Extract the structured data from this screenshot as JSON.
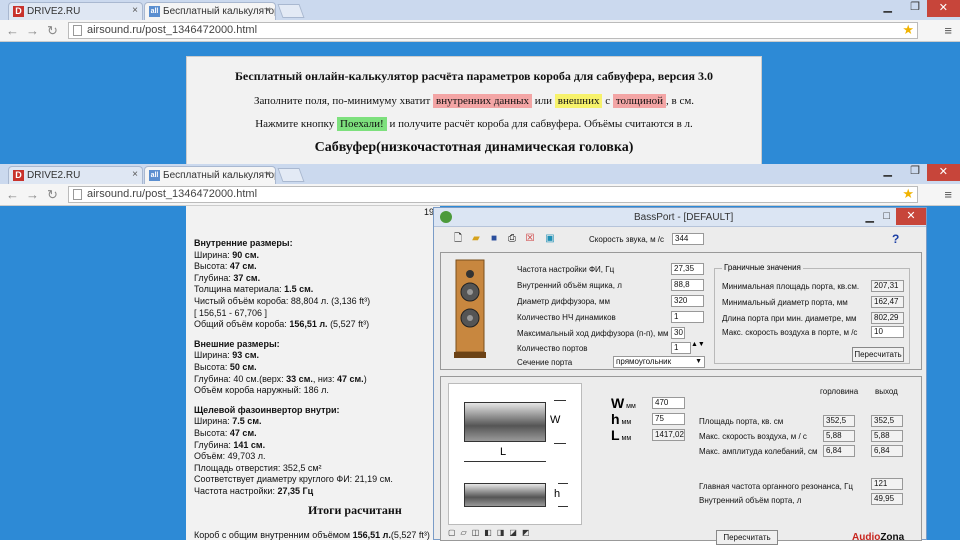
{
  "browser_back": {
    "tabs": [
      {
        "favicon": "D",
        "label": "DRIVE2.RU"
      },
      {
        "favicon": "all",
        "label": "Бесплатный калькулятор"
      }
    ],
    "url": "airsound.ru/post_1346472000.html"
  },
  "page_back": {
    "title": "Бесплатный онлайн-калькулятор расчёта параметров короба для сабвуфера, версия 3.0",
    "line1_a": "Заполните поля, по-минимуму хватит",
    "line1_inner": "внутренних данных",
    "line1_or": "или",
    "line1_outer": "внешних",
    "line1_with": "с",
    "line1_thick": "толщиной",
    "line1_end": ", в см.",
    "line2_a": "Нажмите кнопку",
    "line2_btn": "Поехали!",
    "line2_b": "и получите расчёт короба для сабвуфера. Объёмы считаются в л.",
    "subtitle": "Сабвуфер(низкочастотная динамическая головка)"
  },
  "browser_front": {
    "tabs": [
      {
        "favicon": "D",
        "label": "DRIVE2.RU"
      },
      {
        "favicon": "all",
        "label": "Бесплатный калькулятор"
      }
    ],
    "url": "airsound.ru/post_1346472000.html"
  },
  "results": {
    "top_fragment": "19",
    "inner_header": "Внутренние размеры:",
    "inner": [
      {
        "k": "Ширина: ",
        "v": "90 см."
      },
      {
        "k": "Высота: ",
        "v": "47 см."
      },
      {
        "k": "Глубина: ",
        "v": "37 см."
      },
      {
        "k": "Толщина материала: ",
        "v": "1.5 см."
      }
    ],
    "net_volume": "Чистый объём короба: 88,804 л. (3,136 ft³)",
    "net_range": "[ 156,51 - 67,706 ]",
    "total_volume_k": "Общий объём короба: ",
    "total_volume_v": "156,51 л.",
    "total_volume_tail": " (5,527 ft³)",
    "outer_header": "Внешние размеры:",
    "outer": [
      {
        "k": "Ширина: ",
        "v": "93 см."
      },
      {
        "k": "Высота: ",
        "v": "50 см."
      }
    ],
    "outer_depth_a": "Глубина: 40 см.(верх: ",
    "outer_depth_b": "33 см.",
    "outer_depth_c": ", низ: ",
    "outer_depth_d": "47 см.",
    "outer_depth_e": ")",
    "outer_volume": "Объём короба наружный: 186 л.",
    "port_header": "Щелевой фазоинвертор внутри:",
    "port": [
      {
        "k": "Ширина: ",
        "v": "7.5 см."
      },
      {
        "k": "Высота: ",
        "v": "47 см."
      },
      {
        "k": "Глубина: ",
        "v": "141 см."
      }
    ],
    "port_volume": "Объём: 49,703 л.",
    "port_area": "Площадь отверстия: 352,5 см²",
    "port_diam": "Соответствует диаметру круглого ФИ: 21,19 см.",
    "port_freq_k": "Частота настройки: ",
    "port_freq_v": "27,35 Гц",
    "itogi": "Итоги расчитанн",
    "final_a": "Короб с общим внутренним объёмом ",
    "final_b": "156,51 л.",
    "final_c": "(5,527 ft³)"
  },
  "bassport": {
    "title": "BassPort - [DEFAULT]",
    "sound_speed_label": "Скорость звука, м /с",
    "sound_speed_value": "344",
    "help": "?",
    "params": [
      {
        "label": "Частота настройки ФИ, Гц",
        "value": "27,35"
      },
      {
        "label": "Внутренний объём ящика, л",
        "value": "88,8"
      },
      {
        "label": "Диаметр диффузора, мм",
        "value": "320"
      },
      {
        "label": "Количество НЧ динамиков",
        "value": "1"
      },
      {
        "label": "Максимальный ход диффузора (п-п), мм",
        "value": "30"
      },
      {
        "label": "Количество портов",
        "value": "1"
      }
    ],
    "port_section_label": "Сечение порта",
    "port_section_value": "прямоугольник",
    "limits_caption": "Граничные значения",
    "limits": [
      {
        "label": "Минимальная площадь порта, кв.см.",
        "value": "207,31"
      },
      {
        "label": "Минимальный диаметр порта, мм",
        "value": "162,47"
      },
      {
        "label": "Длина порта при мин. диаметре, мм",
        "value": "802,29"
      },
      {
        "label": "Макс. скорость воздуха в порте, м /с",
        "value": "10"
      }
    ],
    "recalc": "Пересчитать",
    "dims": [
      {
        "letter": "W",
        "unit": "мм",
        "value": "470"
      },
      {
        "letter": "h",
        "unit": "мм",
        "value": "75"
      },
      {
        "letter": "L",
        "unit": "мм",
        "value": "1417,02"
      }
    ],
    "drawing_labels": {
      "w": "W",
      "l": "L",
      "h": "h"
    },
    "col_throat": "горловина",
    "col_exit": "выход",
    "port_rows": [
      {
        "label": "Площадь порта, кв. см",
        "a": "352,5",
        "b": "352,5"
      },
      {
        "label": "Макс. скорость воздуха, м / с",
        "a": "5,88",
        "b": "5,88"
      },
      {
        "label": "Макс. амплитуда колебаний, см",
        "a": "6,84",
        "b": "6,84"
      }
    ],
    "resonance_label": "Главная частота органного резонанса, Гц",
    "resonance_value": "121",
    "inner_port_volume_label": "Внутренний объём порта, л",
    "inner_port_volume_value": "49,95",
    "recalc2": "Пересчитать",
    "brand_a": "Audio",
    "brand_b": "Zona",
    "colors": {
      "titlebar": "#dbe5f3",
      "close": "#c7453a",
      "brand": "#c7251e"
    }
  }
}
